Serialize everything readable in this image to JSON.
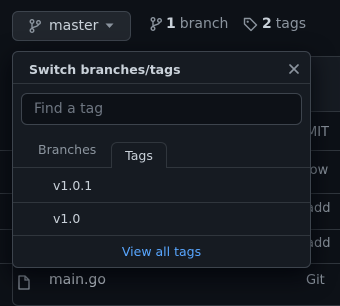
{
  "header": {
    "branch_button_label": "master",
    "branches_count": "1",
    "branches_label": "branch",
    "tags_count": "2",
    "tags_label": "tags"
  },
  "dropdown": {
    "title": "Switch branches/tags",
    "search_placeholder": "Find a tag",
    "tabs": [
      {
        "label": "Branches",
        "selected": false
      },
      {
        "label": "Tags",
        "selected": true
      }
    ],
    "tags": [
      "v1.0.1",
      "v1.0"
    ],
    "view_all_label": "View all tags"
  },
  "file_table": {
    "commit_fragments": [
      "MIT",
      "low",
      "add",
      "add"
    ],
    "last_row": {
      "name": "main.go",
      "commit": "Git"
    }
  },
  "colors": {
    "background": "#0d1117",
    "panel": "#161b22",
    "border": "#30363d",
    "link": "#58a6ff",
    "text": "#c9d1d9",
    "muted": "#8b949e"
  }
}
